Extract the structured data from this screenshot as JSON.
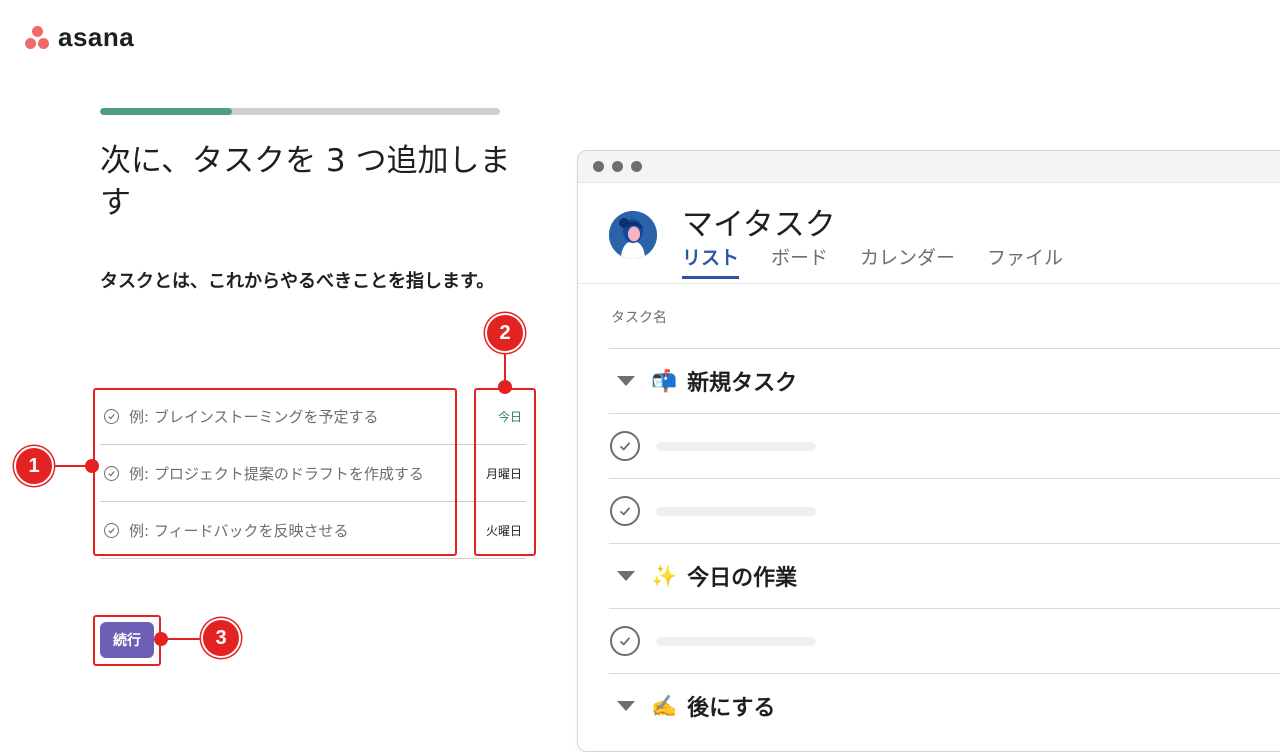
{
  "brand": {
    "name": "asana",
    "color": "#f06a6a"
  },
  "onboarding": {
    "progress": 0.33,
    "heading": "次に、タスクを 3 つ追加します",
    "subtext": "タスクとは、これからやるべきことを指します。",
    "tasks": [
      {
        "name": "例: ブレインストーミングを予定する",
        "due": "今日"
      },
      {
        "name": "例: プロジェクト提案のドラフトを作成する",
        "due": "月曜日"
      },
      {
        "name": "例: フィードバックを反映させる",
        "due": "火曜日"
      }
    ],
    "continue_label": "続行",
    "accent": "#6d5fb5"
  },
  "callouts": {
    "c1": "1",
    "c2": "2",
    "c3": "3",
    "color": "#e52222"
  },
  "preview": {
    "title": "マイタスク",
    "tabs": [
      "リスト",
      "ボード",
      "カレンダー",
      "ファイル"
    ],
    "active_tab": "リスト",
    "column_header": "タスク名",
    "sections": [
      {
        "emoji": "📬",
        "title": "新規タスク"
      },
      {
        "emoji": "✨",
        "title": "今日の作業"
      },
      {
        "emoji": "✍️",
        "title": "後にする"
      }
    ]
  }
}
